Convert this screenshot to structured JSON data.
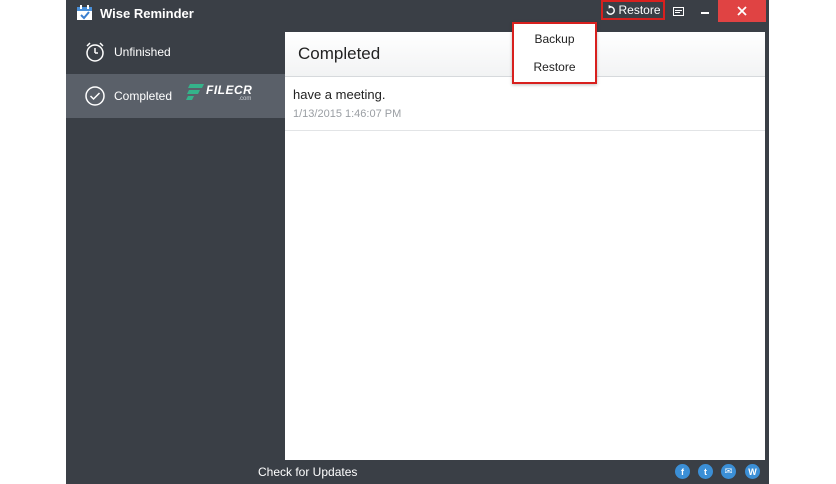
{
  "window": {
    "title": "Wise Reminder",
    "restore_label": "Restore"
  },
  "sidebar": {
    "items": [
      {
        "label": "Unfinished",
        "icon": "alarm-clock-icon"
      },
      {
        "label": "Completed",
        "icon": "check-circle-icon",
        "active": true
      }
    ],
    "watermark": {
      "text": "FILECR",
      "subtext": ".com"
    }
  },
  "content": {
    "title": "Completed",
    "tasks": [
      {
        "title": "have a meeting.",
        "time": "1/13/2015 1:46:07 PM"
      }
    ]
  },
  "dropdown": {
    "items": [
      "Backup",
      "Restore"
    ]
  },
  "footer": {
    "check_updates": "Check for Updates",
    "social": [
      {
        "icon": "facebook-icon",
        "glyph": "f"
      },
      {
        "icon": "twitter-icon",
        "glyph": "t"
      },
      {
        "icon": "email-icon",
        "glyph": "✉"
      },
      {
        "icon": "wise-icon",
        "glyph": "W"
      }
    ]
  },
  "colors": {
    "app_background": "#3a3f46",
    "active_nav": "#5a6069",
    "close_button": "#e04343",
    "highlight_border": "#d8201e",
    "social": "#3b8fd6"
  }
}
